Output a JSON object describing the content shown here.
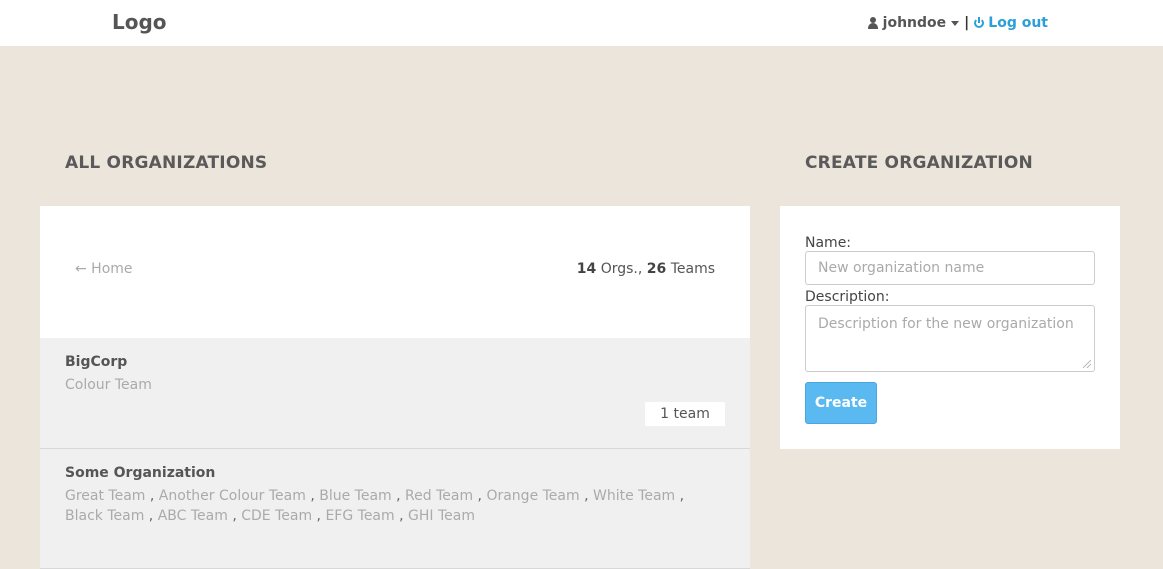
{
  "header": {
    "logo": "Logo",
    "username": "johndoe",
    "separator": "|",
    "logout_label": "Log out",
    "accent_color": "#2a9fd8"
  },
  "all_orgs": {
    "title": "ALL ORGANIZATIONS",
    "home_link": "← Home",
    "orgs_count": "14",
    "orgs_label": "Orgs.,",
    "teams_count": "26",
    "teams_label": "Teams",
    "organizations": [
      {
        "name": "BigCorp",
        "teams": [
          "Colour Team"
        ],
        "team_count_label": "1 team"
      },
      {
        "name": "Some Organization",
        "teams": [
          "Great Team",
          "Another Colour Team",
          "Blue Team",
          "Red Team",
          "Orange Team",
          "White Team",
          "Black Team",
          "ABC Team",
          "CDE Team",
          "EFG Team",
          "GHI Team"
        ]
      }
    ]
  },
  "create_org": {
    "title": "CREATE ORGANIZATION",
    "name_label": "Name:",
    "name_placeholder": "New organization name",
    "description_label": "Description:",
    "description_placeholder": "Description for the new organization",
    "create_button": "Create",
    "button_color": "#5bb9f2"
  }
}
